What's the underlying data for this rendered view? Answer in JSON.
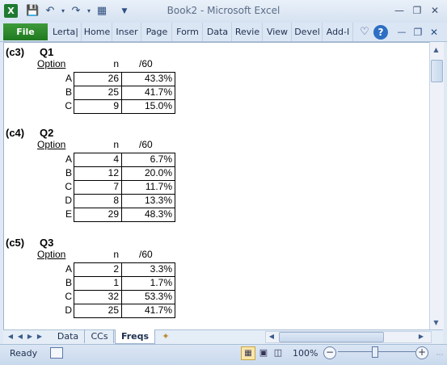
{
  "window": {
    "title": "Book2  -  Microsoft Excel"
  },
  "ribbon": {
    "file_tab": "File",
    "tabs": [
      "Lerta|",
      "Home",
      "Inser",
      "Page",
      "Form",
      "Data",
      "Revie",
      "View",
      "Devel",
      "Add-I"
    ]
  },
  "sections": [
    {
      "tag": "(c3)",
      "question": "Q1",
      "header": {
        "option": "Option",
        "n": "n",
        "pct": "/60"
      },
      "rows": [
        {
          "option": "A",
          "n": "26",
          "pct": "43.3%"
        },
        {
          "option": "B",
          "n": "25",
          "pct": "41.7%"
        },
        {
          "option": "C",
          "n": "9",
          "pct": "15.0%"
        }
      ]
    },
    {
      "tag": "(c4)",
      "question": "Q2",
      "header": {
        "option": "Option",
        "n": "n",
        "pct": "/60"
      },
      "rows": [
        {
          "option": "A",
          "n": "4",
          "pct": "6.7%"
        },
        {
          "option": "B",
          "n": "12",
          "pct": "20.0%"
        },
        {
          "option": "C",
          "n": "7",
          "pct": "11.7%"
        },
        {
          "option": "D",
          "n": "8",
          "pct": "13.3%"
        },
        {
          "option": "E",
          "n": "29",
          "pct": "48.3%"
        }
      ]
    },
    {
      "tag": "(c5)",
      "question": "Q3",
      "header": {
        "option": "Option",
        "n": "n",
        "pct": "/60"
      },
      "rows": [
        {
          "option": "A",
          "n": "2",
          "pct": "3.3%"
        },
        {
          "option": "B",
          "n": "1",
          "pct": "1.7%"
        },
        {
          "option": "C",
          "n": "32",
          "pct": "53.3%"
        },
        {
          "option": "D",
          "n": "25",
          "pct": "41.7%"
        }
      ]
    }
  ],
  "sheet_tabs": [
    "Data",
    "CCs",
    "Freqs"
  ],
  "active_sheet": "Freqs",
  "status": {
    "ready": "Ready",
    "zoom": "100%",
    "zoom_level_percent": 100
  },
  "colors": {
    "file_tab": "#2a8a2a",
    "excel_icon": "#1e7a30"
  },
  "icons": [
    "excel-icon",
    "save-icon",
    "undo-icon",
    "redo-icon",
    "customize-icon",
    "minimize-icon",
    "restore-icon",
    "close-icon",
    "heart-icon",
    "help-icon",
    "macro-record-icon"
  ]
}
